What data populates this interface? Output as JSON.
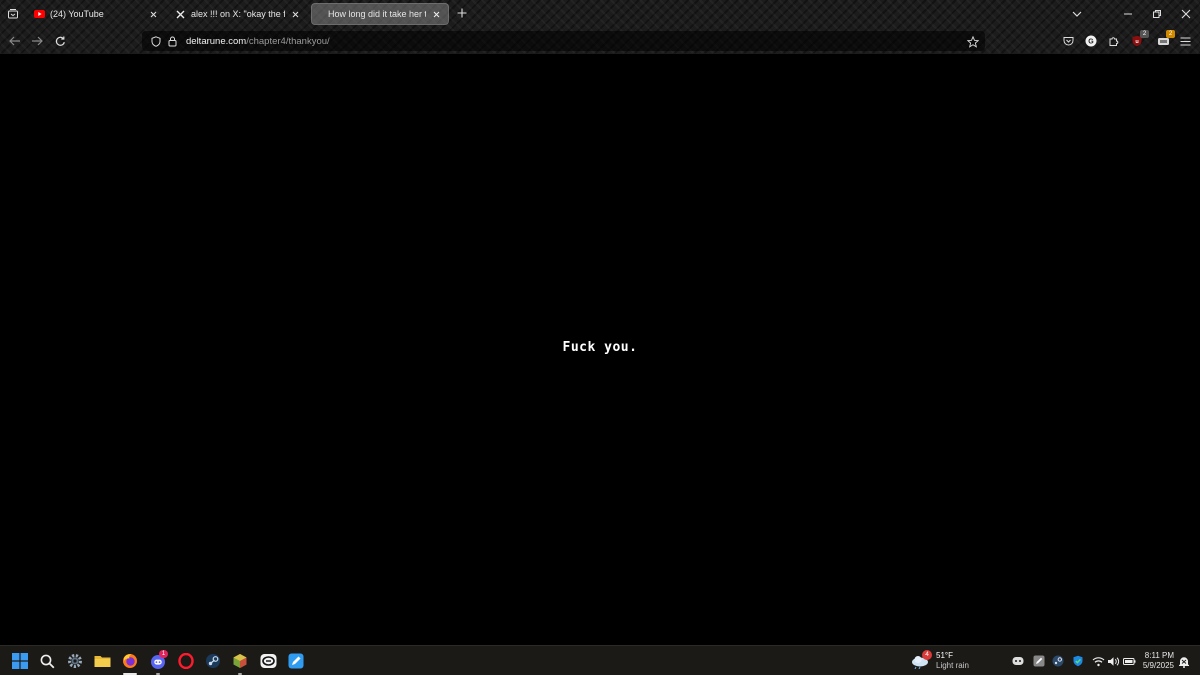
{
  "browser": {
    "tabs": [
      {
        "title": "(24) YouTube",
        "favicon": "youtube-icon",
        "active": false
      },
      {
        "title": "alex !!! on X: \"okay the fact that",
        "favicon": "x-logo-icon",
        "active": false
      },
      {
        "title": "How long did it take her to sm",
        "favicon": "",
        "active": true
      }
    ],
    "url_host": "deltarune.com",
    "url_path": "/chapter4/thankyou/",
    "extension_badges": {
      "ublock": "2",
      "other": "2"
    }
  },
  "page": {
    "message": "Fuck you."
  },
  "taskbar": {
    "weather": {
      "badge": "4",
      "temp": "51°F",
      "condition": "Light rain"
    },
    "discord_badge": "1",
    "clock": {
      "time": "8:11 PM",
      "date": "5/9/2025"
    }
  },
  "colors": {
    "youtube_red": "#ff0000",
    "active_indicator": "#a8a8a8",
    "taskbar_bg": "#1b1a17",
    "page_bg": "#000000"
  }
}
